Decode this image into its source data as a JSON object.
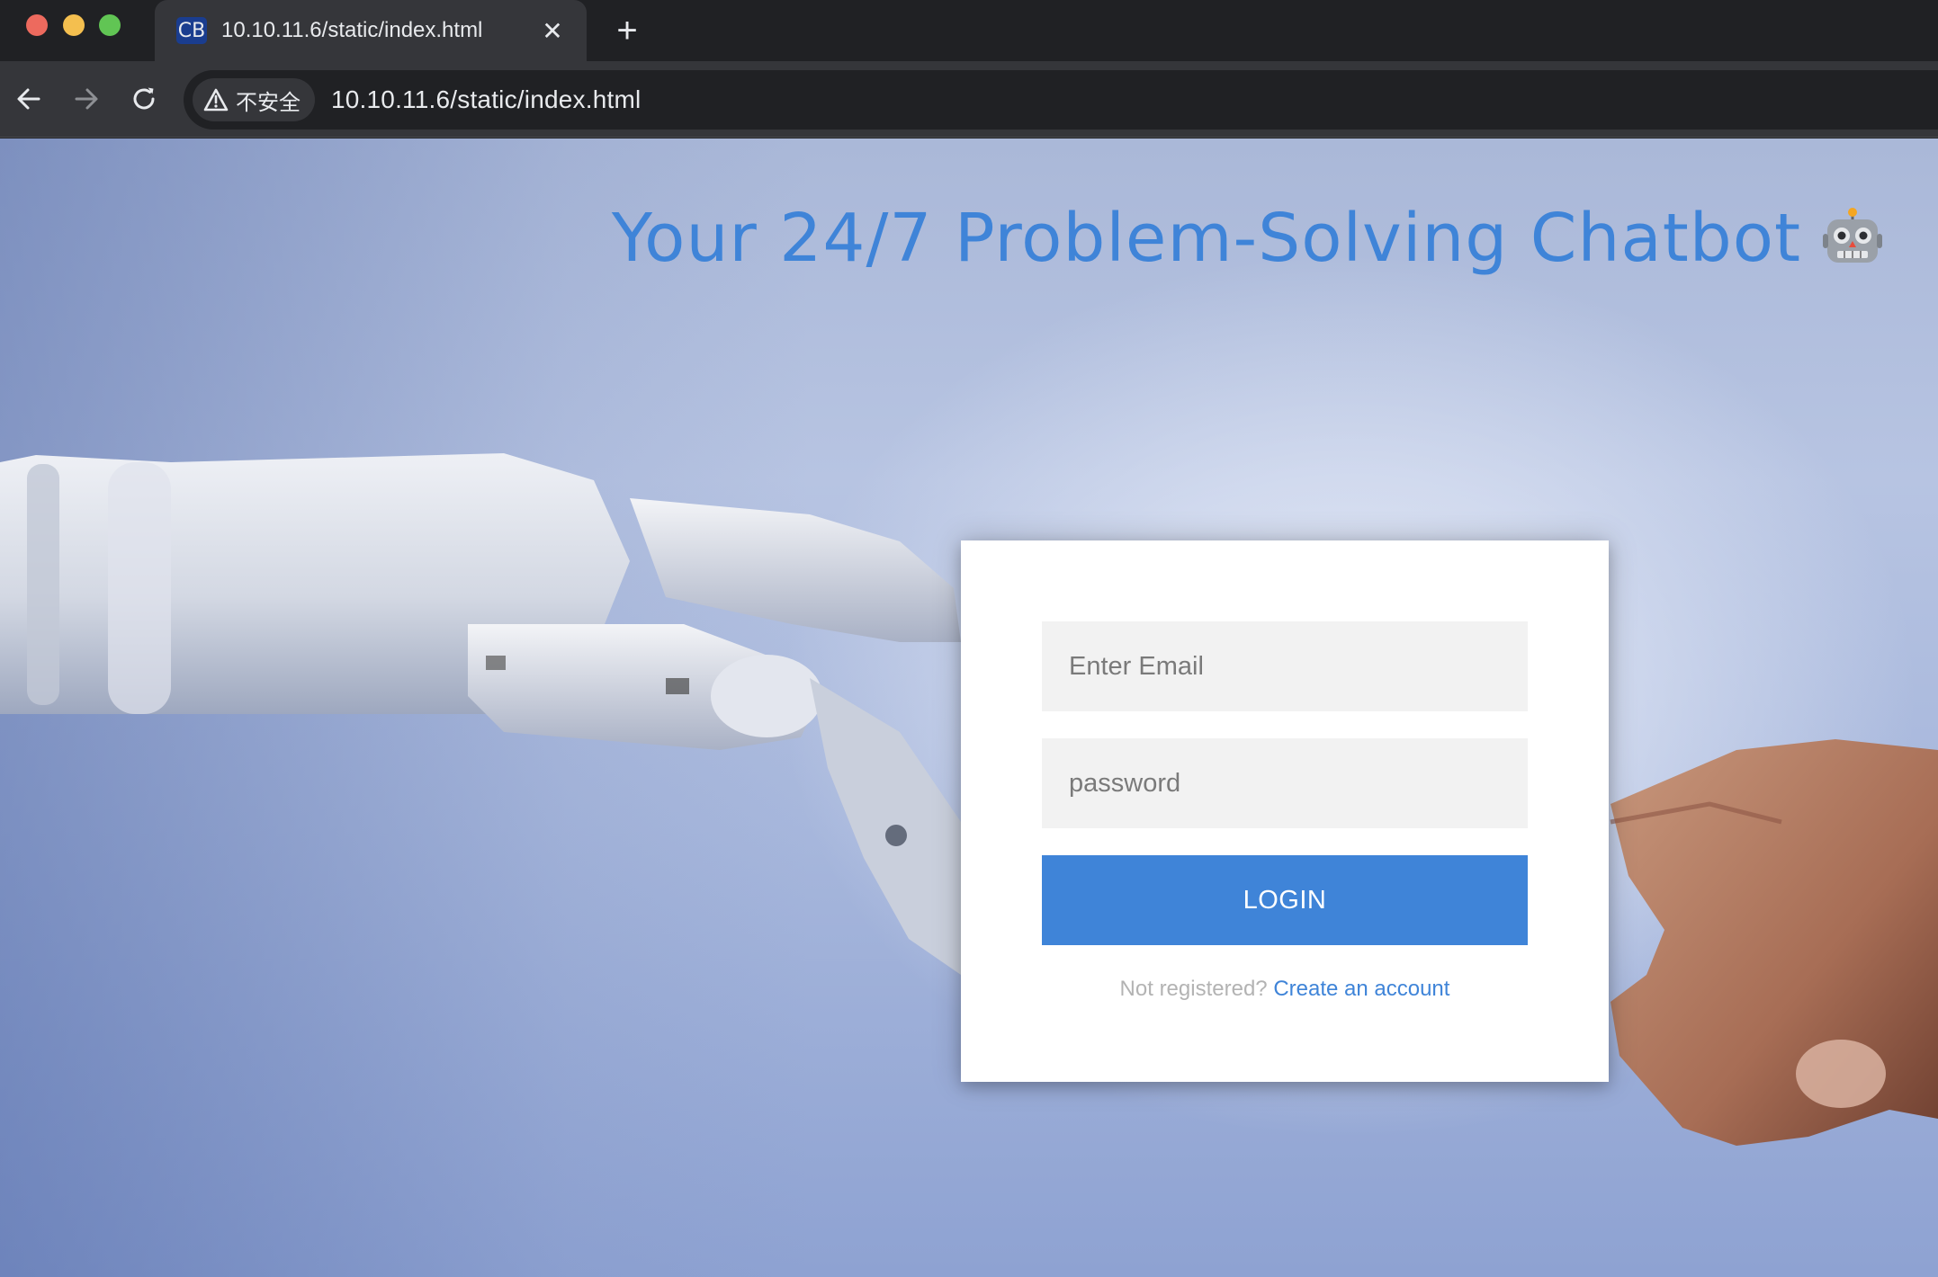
{
  "browser": {
    "tab": {
      "favicon_text": "CB",
      "title": "10.10.11.6/static/index.html",
      "close_glyph": "✕"
    },
    "new_tab_glyph": "+",
    "security_label": "不安全",
    "url": "10.10.11.6/static/index.html"
  },
  "page": {
    "headline": "Your 24/7 Problem-Solving Chatbot",
    "headline_emoji": "robot-face-icon"
  },
  "login": {
    "email_placeholder": "Enter Email",
    "password_placeholder": "password",
    "button_label": "LOGIN",
    "prompt_text": "Not registered?",
    "register_link": "Create an account"
  },
  "colors": {
    "accent": "#3f84d8",
    "card": "#ffffff",
    "field_bg": "#f2f2f2"
  }
}
